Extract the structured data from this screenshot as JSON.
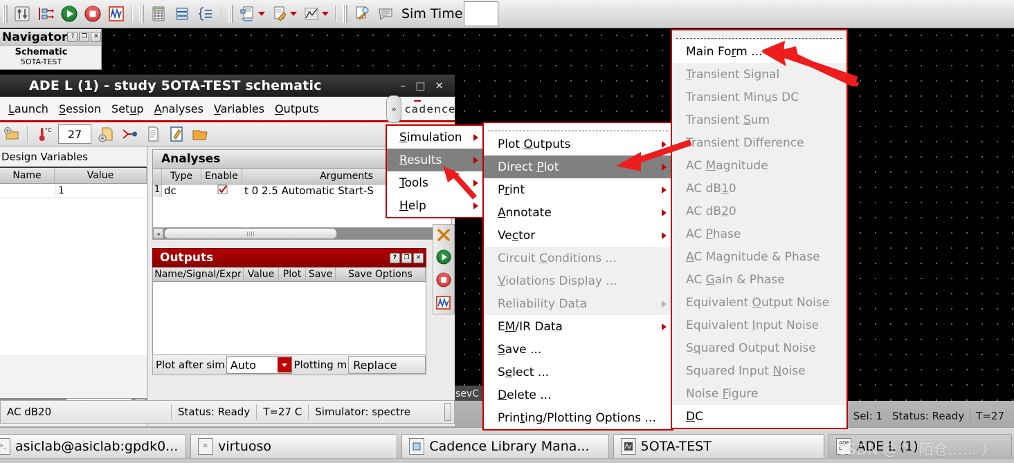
{
  "toolbar_top": {
    "icons": [
      "sliders-icon",
      "netlist-icon",
      "run-simulation-icon",
      "stop-simulation-icon",
      "waveform-icon",
      "calculator-icon",
      "database-icon",
      "braces-icon",
      "netlist-output-icon",
      "annotate-edit-icon",
      "plot-grid-icon",
      "check-results-icon",
      "log-icon"
    ],
    "sim_time_label": "Sim Time",
    "sim_time_value": ""
  },
  "navigator": {
    "title": "Navigator",
    "help_btn": "?",
    "restore_btn": "❐",
    "close_btn": "✕",
    "section": "Schematic",
    "cell": "5OTA-TEST"
  },
  "ade": {
    "title": "ADE L (1) - study 5OTA-TEST schematic",
    "window_buttons": {
      "minimize": "–",
      "maximize": "□",
      "close": "✕"
    },
    "menus": [
      "Launch",
      "Session",
      "Setup",
      "Analyses",
      "Variables",
      "Outputs"
    ],
    "overflow_chevron": "»",
    "brand": "cadence",
    "toolbar_icons": [
      "open-settings-icon",
      "temperature-icon",
      "netlist-settings-icon",
      "stimuli-icon",
      "print-icon",
      "edit-icon",
      "open-results-icon"
    ],
    "temperature_value": "27",
    "design_variables": {
      "title": "Design Variables",
      "columns": [
        "Name",
        "Value"
      ],
      "rows": [
        {
          "name": "",
          "value": "1"
        }
      ]
    },
    "analyses": {
      "title": "Analyses",
      "columns": [
        "Type",
        "Enable",
        "Arguments"
      ],
      "rows": [
        {
          "index": "1",
          "type": "dc",
          "enable": true,
          "arguments": "t 0 2.5 Automatic Start-S"
        }
      ]
    },
    "outputs": {
      "title": "Outputs",
      "help_btn": "?",
      "restore_btn": "❐",
      "close_btn": "✕",
      "columns": [
        "Name/Signal/Expr",
        "Value",
        "Plot",
        "Save",
        "Save Options"
      ],
      "rows": [],
      "plot_after_sim_label": "Plot after sim",
      "plot_after_sim_value": "Auto",
      "plotting_mode_label": "Plotting m",
      "plotting_mode_value": "Replace"
    },
    "run_toolbar_icons": [
      "delete-all-icon",
      "run-icon",
      "stop-icon",
      "waveform-icon"
    ],
    "status_bar": {
      "mode": "AC dB20",
      "status": "Status: Ready",
      "temp": "T=27   C",
      "simulator": "Simulator: spectre"
    }
  },
  "background_status": {
    "selection": "Sel: 1",
    "status": "Status: Ready",
    "temp": "T=27"
  },
  "partial_label": "sevC",
  "menu_results": {
    "items": [
      {
        "label": "Simulation",
        "accel": "S",
        "submenu": true,
        "state": "normal"
      },
      {
        "label": "Results",
        "accel": "R",
        "submenu": true,
        "state": "selected"
      },
      {
        "label": "Tools",
        "accel": "T",
        "submenu": true,
        "state": "normal"
      },
      {
        "label": "Help",
        "accel": "H",
        "submenu": true,
        "state": "normal"
      }
    ]
  },
  "menu_results_sub": {
    "tearoff": true,
    "items": [
      {
        "label": "Plot Outputs",
        "submenu": true,
        "state": "normal"
      },
      {
        "label": "Direct Plot",
        "submenu": true,
        "state": "selected"
      },
      {
        "label": "Print",
        "submenu": true,
        "state": "normal"
      },
      {
        "label": "Annotate",
        "submenu": true,
        "state": "normal"
      },
      {
        "label": "Vector",
        "submenu": true,
        "state": "normal"
      },
      {
        "label": "Circuit Conditions ...",
        "submenu": false,
        "state": "disabled"
      },
      {
        "label": "Violations Display ...",
        "submenu": false,
        "state": "disabled"
      },
      {
        "label": "Reliability Data",
        "submenu": true,
        "state": "disabled"
      },
      {
        "label": "EM/IR Data",
        "submenu": true,
        "state": "normal"
      },
      {
        "label": "Save ...",
        "submenu": false,
        "state": "normal"
      },
      {
        "label": "Select ...",
        "submenu": false,
        "state": "normal"
      },
      {
        "label": "Delete ...",
        "submenu": false,
        "state": "normal"
      },
      {
        "label": "Printing/Plotting Options ...",
        "submenu": false,
        "state": "normal"
      }
    ]
  },
  "menu_direct_plot_sub": {
    "tearoff": true,
    "items": [
      {
        "label": "Main Form ...",
        "state": "normal"
      },
      {
        "label": "Transient Signal",
        "state": "disabled"
      },
      {
        "label": "Transient Minus DC",
        "state": "disabled"
      },
      {
        "label": "Transient Sum",
        "state": "disabled"
      },
      {
        "label": "Transient Difference",
        "state": "disabled"
      },
      {
        "label": "AC Magnitude",
        "state": "disabled"
      },
      {
        "label": "AC dB10",
        "state": "disabled"
      },
      {
        "label": "AC dB20",
        "state": "disabled"
      },
      {
        "label": "AC Phase",
        "state": "disabled"
      },
      {
        "label": "AC Magnitude & Phase",
        "state": "disabled"
      },
      {
        "label": "AC Gain & Phase",
        "state": "disabled"
      },
      {
        "label": "Equivalent Output Noise",
        "state": "disabled"
      },
      {
        "label": "Equivalent Input Noise",
        "state": "disabled"
      },
      {
        "label": "Squared Output Noise",
        "state": "disabled"
      },
      {
        "label": "Squared Input Noise",
        "state": "disabled"
      },
      {
        "label": "Noise Figure",
        "state": "disabled"
      },
      {
        "label": "DC",
        "state": "normal"
      }
    ]
  },
  "taskbar": {
    "items": [
      {
        "label": "asiclab@asiclab:gpdk0...",
        "icon": "terminal-icon",
        "active": false
      },
      {
        "label": "virtuoso",
        "icon": "virtuoso-icon",
        "active": false
      },
      {
        "label": "Cadence Library Mana...",
        "icon": "library-icon",
        "active": false
      },
      {
        "label": "5OTA-TEST",
        "icon": "schematic-icon",
        "active": false
      },
      {
        "label": "ADE L (1)",
        "icon": "ade-icon",
        "active": true
      }
    ],
    "watermark": "CSDN @^· 陌仓…… ）"
  },
  "colors": {
    "accent_red": "#c00000",
    "outputs_header": "#b40000",
    "menu_selected": "#808080",
    "canvas": "#000000",
    "annotation_arrow": "#ee1c1c"
  }
}
